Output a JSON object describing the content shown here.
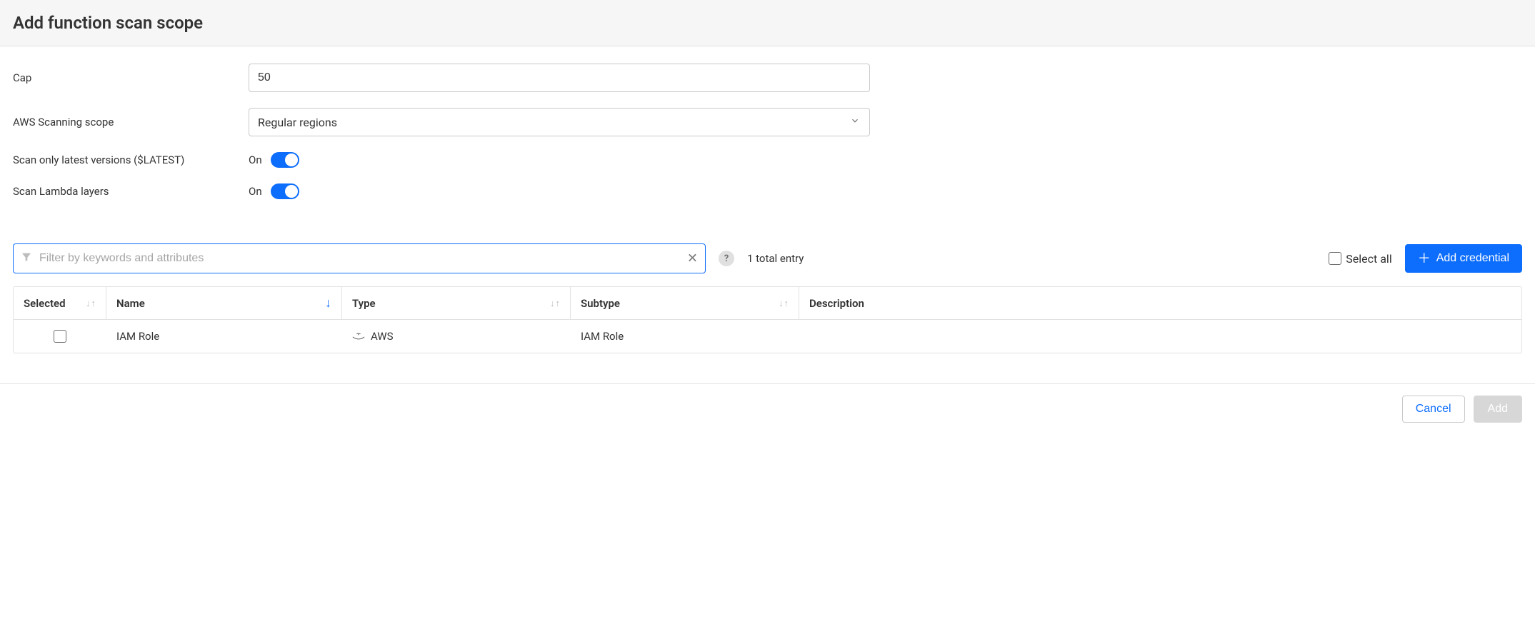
{
  "header": {
    "title": "Add function scan scope"
  },
  "form": {
    "cap": {
      "label": "Cap",
      "value": "50"
    },
    "scope": {
      "label": "AWS Scanning scope",
      "value": "Regular regions"
    },
    "latest": {
      "label": "Scan only latest versions ($LATEST)",
      "state": "On"
    },
    "layers": {
      "label": "Scan Lambda layers",
      "state": "On"
    }
  },
  "filter": {
    "placeholder": "Filter by keywords and attributes",
    "value": "",
    "count_text": "1 total entry",
    "select_all_label": "Select all",
    "add_credential_label": "Add credential"
  },
  "table": {
    "columns": {
      "selected": "Selected",
      "name": "Name",
      "type": "Type",
      "subtype": "Subtype",
      "description": "Description"
    },
    "rows": [
      {
        "selected": false,
        "name": "IAM Role",
        "type": "AWS",
        "subtype": "IAM Role",
        "description": ""
      }
    ]
  },
  "footer": {
    "cancel": "Cancel",
    "add": "Add"
  }
}
